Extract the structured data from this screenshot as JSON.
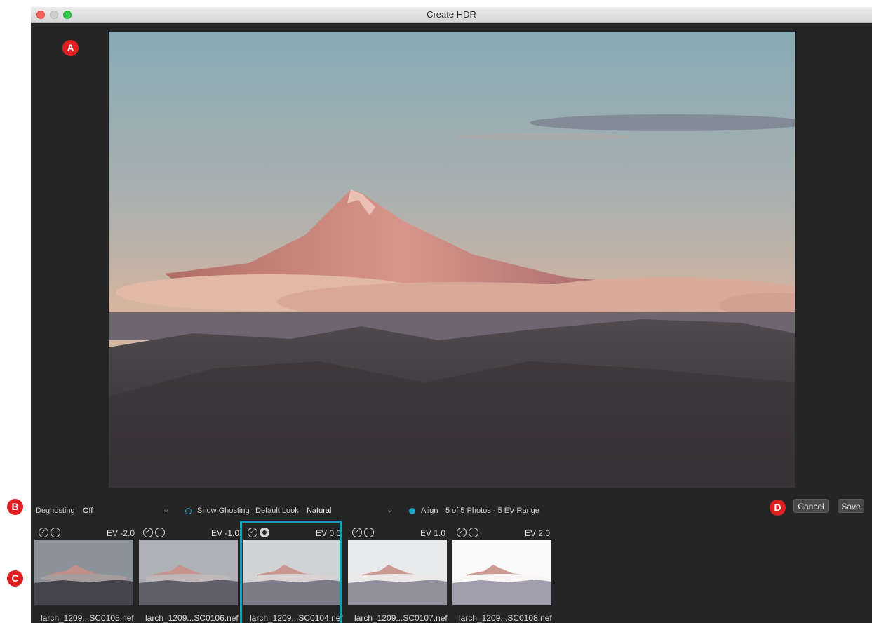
{
  "window": {
    "title": "Create HDR"
  },
  "callouts": {
    "a": "A",
    "b": "B",
    "c": "C",
    "d": "D"
  },
  "controls": {
    "deghosting_label": "Deghosting",
    "deghosting_value": "Off",
    "show_ghosting_label": "Show Ghosting",
    "default_look_label": "Default Look",
    "default_look_value": "Natural",
    "align_label": "Align",
    "summary": "5 of 5 Photos - 5 EV Range"
  },
  "buttons": {
    "cancel": "Cancel",
    "save": "Save"
  },
  "filmstrip": [
    {
      "ev": "EV -2.0",
      "filename": "larch_1209...SC0105.nef",
      "selected": false,
      "brightness": 0.35
    },
    {
      "ev": "EV -1.0",
      "filename": "larch_1209...SC0106.nef",
      "selected": false,
      "brightness": 0.55
    },
    {
      "ev": "EV 0.0",
      "filename": "larch_1209...SC0104.nef",
      "selected": true,
      "brightness": 0.75
    },
    {
      "ev": "EV 1.0",
      "filename": "larch_1209...SC0107.nef",
      "selected": false,
      "brightness": 0.9
    },
    {
      "ev": "EV 2.0",
      "filename": "larch_1209...SC0108.nef",
      "selected": false,
      "brightness": 1.0
    }
  ],
  "colors": {
    "accent": "#1fa2c4",
    "badge": "#e02020",
    "window_bg": "#252525"
  }
}
